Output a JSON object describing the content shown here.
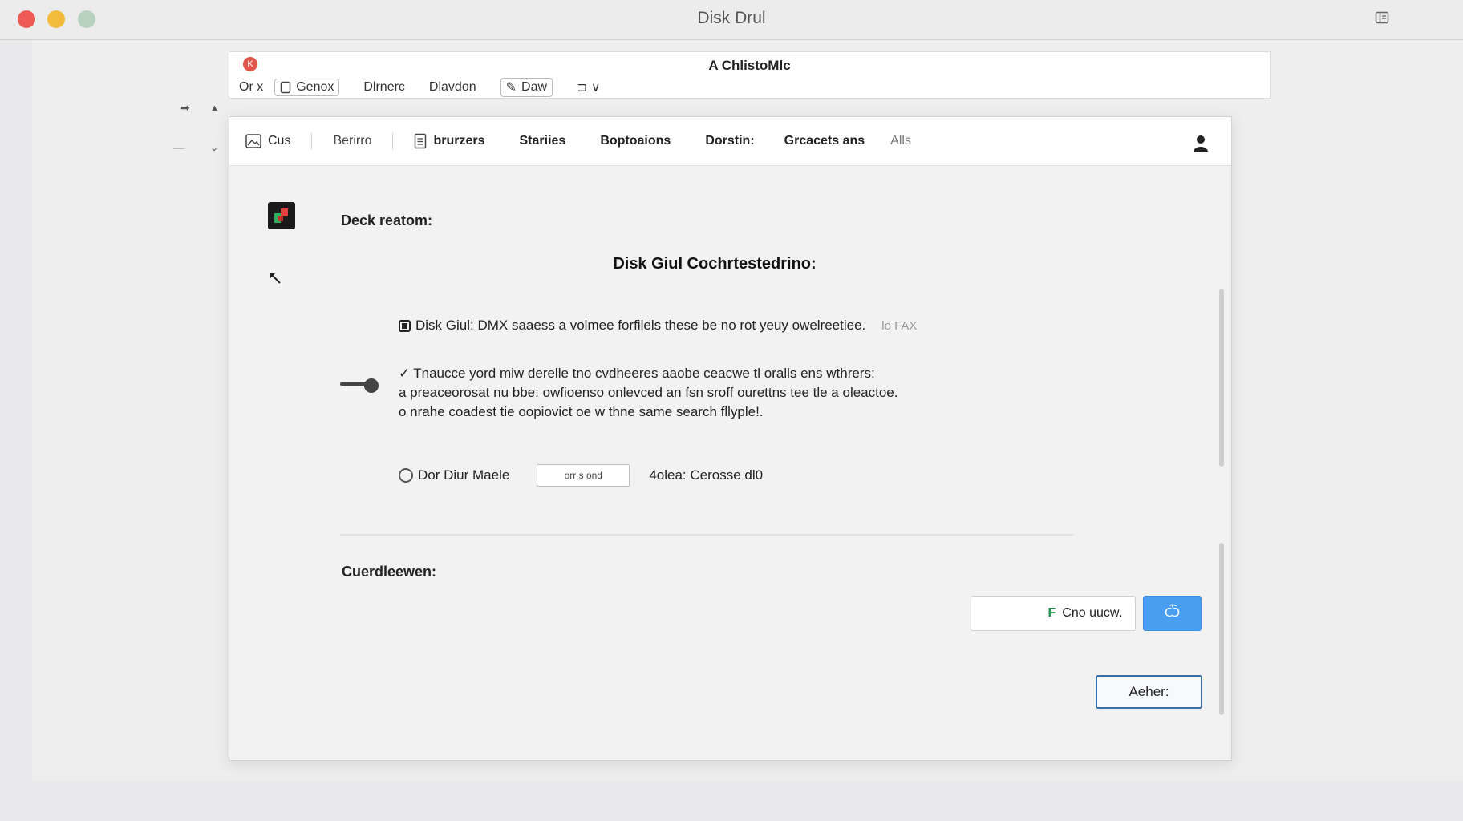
{
  "app": {
    "title": "Disk Drul"
  },
  "subwindow": {
    "title": "A ChlistoMlc",
    "close_glyph": "K",
    "toolbar": [
      {
        "label": "Or x",
        "boxed": false,
        "icon": ""
      },
      {
        "label": "Genox",
        "boxed": true,
        "icon": "document-icon"
      },
      {
        "label": "Dlrnerc",
        "boxed": false,
        "icon": ""
      },
      {
        "label": "Dlavdon",
        "boxed": false,
        "icon": ""
      },
      {
        "label": "Daw",
        "boxed": true,
        "icon": "pen-icon"
      },
      {
        "label": "⊐ ∨",
        "boxed": false,
        "icon": ""
      }
    ]
  },
  "tabs": [
    {
      "label": "Cus",
      "icon": "image-icon",
      "weight": "normal"
    },
    {
      "label": "Berirro",
      "icon": "",
      "weight": "normal"
    },
    {
      "label": "brurzers",
      "icon": "document-icon",
      "weight": "bold"
    },
    {
      "label": "Stariies",
      "icon": "",
      "weight": "bold"
    },
    {
      "label": "Boptoaions",
      "icon": "",
      "weight": "bold"
    },
    {
      "label": "Dorstin:",
      "icon": "",
      "weight": "bold"
    },
    {
      "label": "Grcacets ans",
      "icon": "",
      "weight": "bold"
    },
    {
      "label": "Alls",
      "icon": "",
      "weight": "dim"
    }
  ],
  "main": {
    "section_label": "Deck reatom:",
    "heading": "Disk Giul Cochrtestedrino:",
    "info": {
      "text": "Disk Giul: DMX saaess a volmee forfilels these be no rot yeuy owelreetiee.",
      "muted": "lo FAX"
    },
    "paragraph": [
      "Tnaucce yord miw derelle tno cvdheeres aaobe ceacwe tl oralls ens wthrers:",
      "a preaceorosat nu bbe: owfioenso onlevced an fsn sroff ourettns tee tle a oleactoe.",
      "o nrahe coadest tie oopiovict oe w thne same search fllyple!."
    ],
    "mode": {
      "label": "Dor Diur Maele",
      "input_value": "orr s ond",
      "extra": "4olea: Cerosse dl0"
    },
    "footer_label": "Cuerdleewen:",
    "buttons": {
      "white": {
        "flag": "F",
        "label": "Cno uucw."
      },
      "blue": "Ѽ",
      "action": "Aeher:"
    }
  },
  "colors": {
    "accent_blue": "#4a9ef2",
    "action_border": "#3c6ea6",
    "close_red": "#ee5b56",
    "minimize_yellow": "#f3bb3c",
    "zoom_green": "#b9d2bf"
  }
}
